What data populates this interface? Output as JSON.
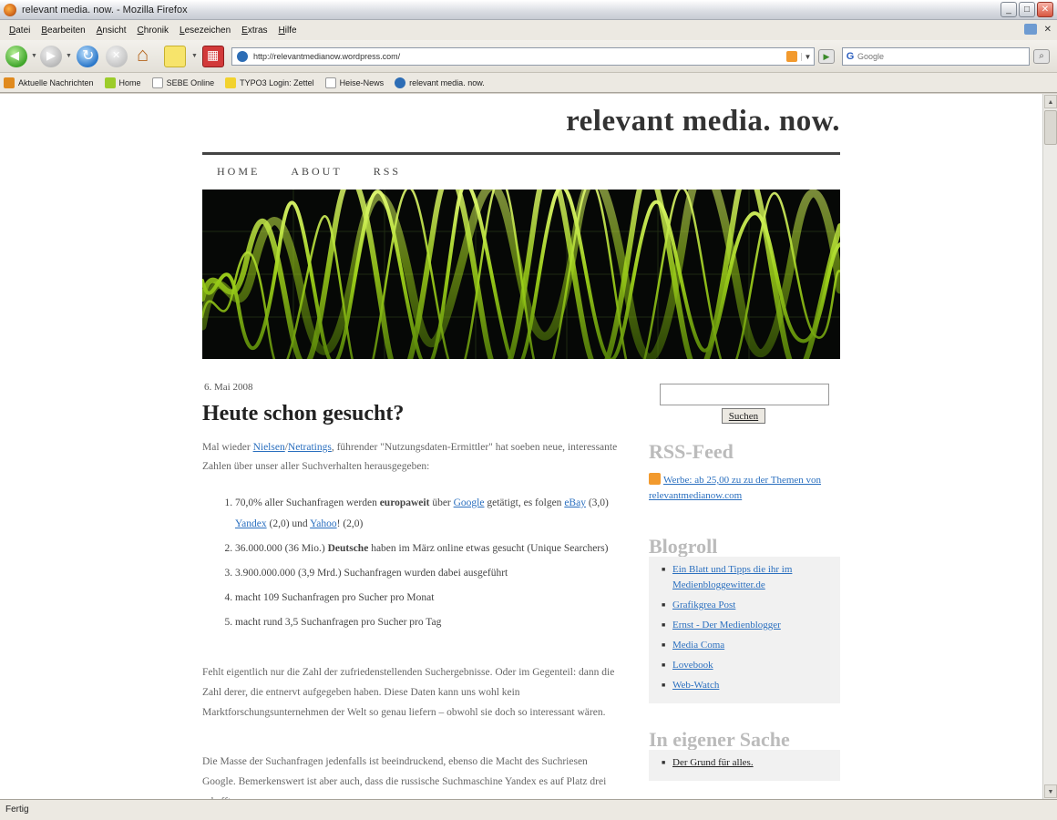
{
  "window": {
    "title": "relevant media. now. - Mozilla Firefox",
    "controls": {
      "minimize": "_",
      "maximize": "□",
      "close": "✕"
    }
  },
  "menu": [
    "Datei",
    "Bearbeiten",
    "Ansicht",
    "Chronik",
    "Lesezeichen",
    "Extras",
    "Hilfe"
  ],
  "toolbar": {
    "url": "http://relevantmedianow.wordpress.com/",
    "search_placeholder": "Google",
    "search_engine_icon": "G"
  },
  "bookmarks": [
    {
      "label": "Aktuelle Nachrichten",
      "icon_color": "#e08a1e"
    },
    {
      "label": "Home",
      "icon_color": "#9ccc2a"
    },
    {
      "label": "SEBE Online",
      "icon_color": "#ffffff"
    },
    {
      "label": "TYPO3 Login: Zettel",
      "icon_color": "#f2d22e"
    },
    {
      "label": "Heise-News",
      "icon_color": "#ffffff"
    },
    {
      "label": "relevant media. now.",
      "icon_color": "#2d6db5"
    }
  ],
  "status": "Fertig",
  "blog": {
    "title": "relevant media. now.",
    "nav": [
      "HOME",
      "ABOUT",
      "RSS"
    ],
    "post": {
      "date": "6. Mai 2008",
      "title": "Heute schon gesucht?",
      "intro_prefix": "Mal wieder ",
      "intro_link1": "Nielsen",
      "intro_sep": "/",
      "intro_link2": "Netratings",
      "intro_suffix": ", führender \"Nutzungsdaten-Ermittler\" hat soeben neue, interessante Zahlen über unser aller Suchverhalten herausgegeben:",
      "list": [
        {
          "a": "70,0% aller Suchanfragen werden ",
          "b": "europaweit",
          "c": " über ",
          "link1": "Google",
          "d": " getätigt, es folgen ",
          "link2": "eBay",
          "e": " (3,0) ",
          "link3": "Yandex",
          "f": " (2,0) und ",
          "link4": "Yahoo",
          "g": "! (2,0)"
        },
        {
          "a": "36.000.000 (36 Mio.) ",
          "b": "Deutsche",
          "c": " haben im März online etwas gesucht (Unique Searchers)"
        },
        {
          "a": "3.900.000.000 (3,9 Mrd.) Suchanfragen wurden dabei ausgeführt"
        },
        {
          "a": "macht 109 Suchanfragen pro Sucher pro Monat"
        },
        {
          "a": "macht rund 3,5 Suchanfragen pro Sucher pro Tag"
        }
      ],
      "para1": "Fehlt eigentlich nur die Zahl der zufriedenstellenden Suchergebnisse. Oder im Gegenteil: dann die Zahl derer, die entnervt aufgegeben haben. Diese Daten kann uns wohl kein Marktforschungsunternehmen der Welt so genau liefern – obwohl sie doch so interessant wären.",
      "para2": "Die Masse der Suchanfragen jedenfalls ist beeindruckend, ebenso die Macht des Suchriesen Google. Bemerkenswert ist aber auch, dass die russische Suchmaschine Yandex es auf Platz drei schafft."
    },
    "sidebar": {
      "search_button": "Suchen",
      "rss_heading": "RSS-Feed",
      "rss_item": "Werbe: ab 25,00 zu zu der Themen von relevantmedianow.com",
      "blogroll_heading": "Blogroll",
      "blogroll": [
        "Ein Blatt und Tipps die ihr im Medienbloggewitter.de",
        "Grafikgrea Post",
        "Ernst - Der Medienblogger",
        "Media Coma",
        "Lovebook",
        "Web-Watch"
      ],
      "own_heading": "In eigener Sache",
      "own_items": [
        "Der Grund für alles."
      ]
    }
  }
}
